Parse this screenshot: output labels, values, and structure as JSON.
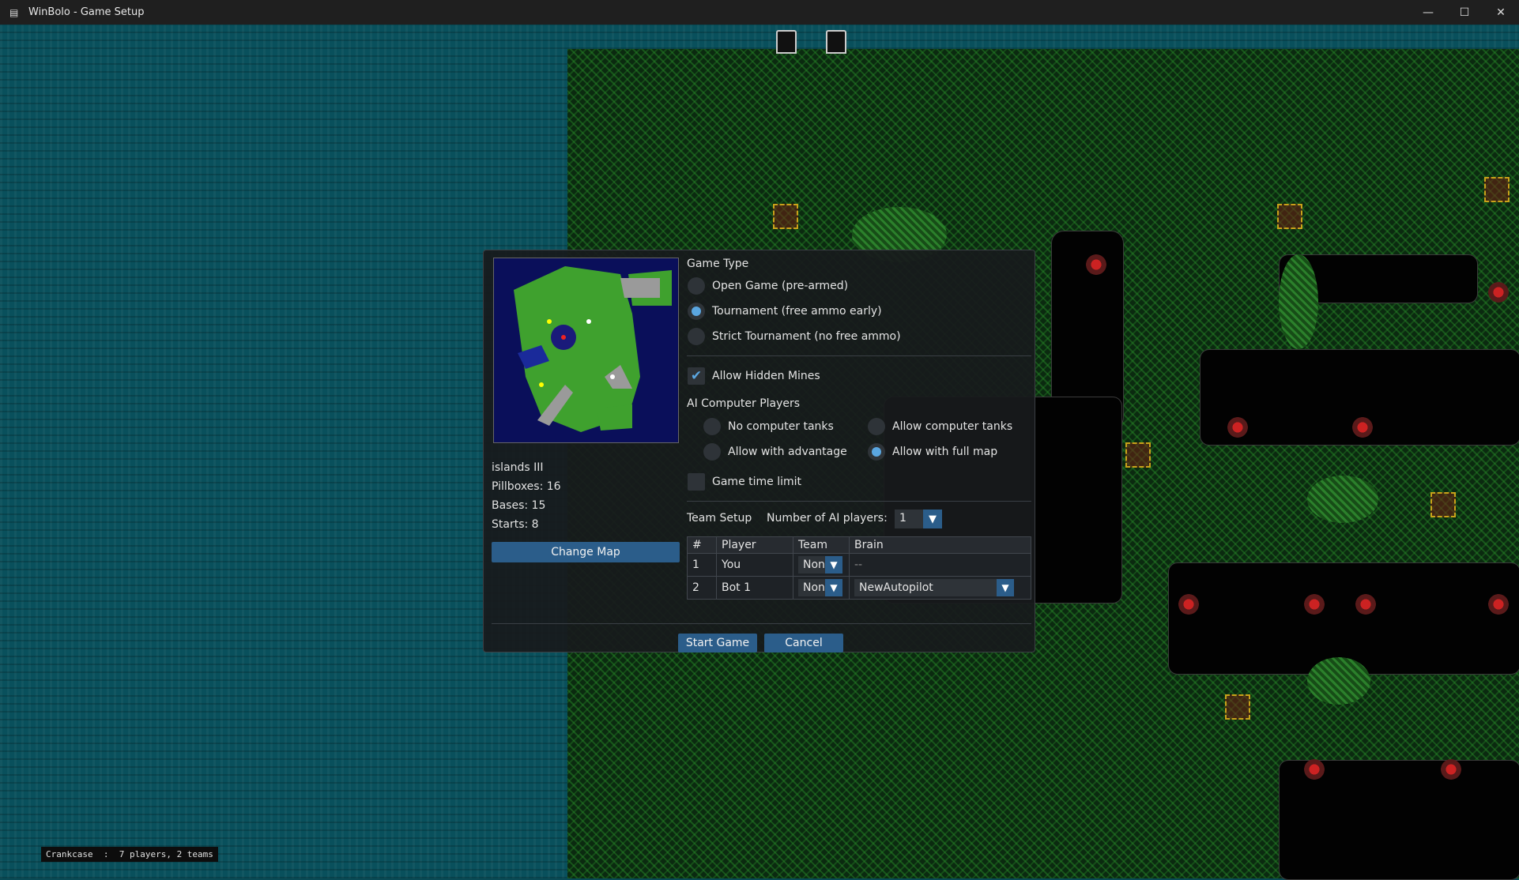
{
  "window": {
    "title": "WinBolo - Game Setup",
    "app_icon": "winbolo-icon",
    "minimize_icon": "minimize-icon",
    "maximize_icon": "maximize-icon",
    "close_icon": "close-icon"
  },
  "status_bar": {
    "text": "Crankcase  :  7 players, 2 teams"
  },
  "map_info": {
    "name": "islands III",
    "pillboxes": "Pillboxes: 16",
    "bases": "Bases: 15",
    "starts": "Starts: 8",
    "change_map": "Change Map"
  },
  "game_type": {
    "heading": "Game Type",
    "options": [
      {
        "label": "Open Game (pre-armed)",
        "selected": false
      },
      {
        "label": "Tournament (free ammo early)",
        "selected": true
      },
      {
        "label": "Strict Tournament (no free ammo)",
        "selected": false
      }
    ]
  },
  "hidden_mines": {
    "label": "Allow Hidden Mines",
    "checked": true
  },
  "ai_players": {
    "heading": "AI Computer Players",
    "options": [
      {
        "label": "No computer tanks",
        "selected": false
      },
      {
        "label": "Allow computer tanks",
        "selected": false
      },
      {
        "label": "Allow with advantage",
        "selected": false
      },
      {
        "label": "Allow with full map",
        "selected": true
      }
    ]
  },
  "time_limit": {
    "label": "Game time limit",
    "checked": false
  },
  "team_setup": {
    "heading": "Team Setup",
    "ai_count_label": "Number of AI players:",
    "ai_count_value": "1",
    "columns": [
      "#",
      "Player",
      "Team",
      "Brain"
    ],
    "rows": [
      {
        "num": "1",
        "player": "You",
        "team": "None",
        "brain": "--"
      },
      {
        "num": "2",
        "player": "Bot 1",
        "team": "None",
        "brain": "NewAutopilot"
      }
    ]
  },
  "actions": {
    "start": "Start Game",
    "cancel": "Cancel"
  },
  "colors": {
    "accent": "#2b5d8a",
    "radio_on": "#5aa6e0",
    "water": "#09505c",
    "dialog_bg": "#181a1c"
  }
}
